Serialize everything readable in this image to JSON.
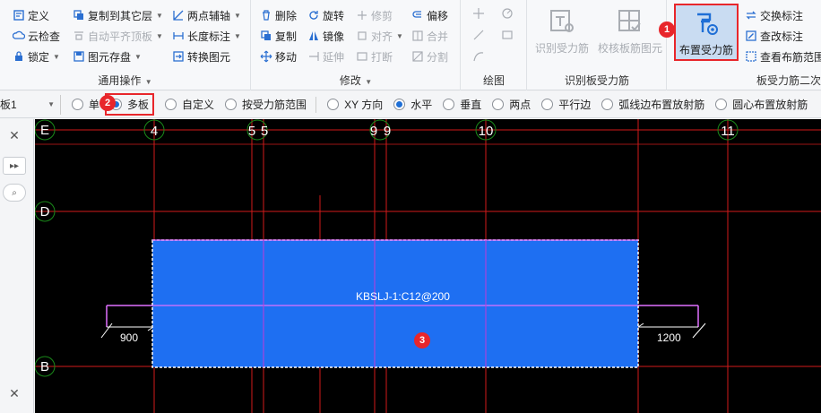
{
  "ribbon": {
    "general": {
      "title": "通用操作",
      "items": [
        "定义",
        "云检查",
        "锁定",
        "复制到其它层",
        "自动平齐顶板",
        "图元存盘",
        "两点辅轴",
        "长度标注",
        "转换图元"
      ]
    },
    "modify": {
      "title": "修改",
      "items": [
        "删除",
        "旋转",
        "修剪",
        "偏移",
        "复制",
        "镜像",
        "对齐",
        "合并",
        "移动",
        "延伸",
        "打断",
        "分割"
      ]
    },
    "draw": {
      "title": "绘图"
    },
    "recognize": {
      "title": "识别板受力筋",
      "identify_label": "识别受力筋",
      "check_label": "校核板筋图元"
    },
    "place": {
      "title": "板受力筋二次",
      "place_label": "布置受力筋",
      "exchange_label": "交换标注",
      "edit_label": "查改标注",
      "view_label": "查看布筋范围"
    }
  },
  "optbar": {
    "layer": "板1",
    "options": [
      "单",
      "多板",
      "自定义",
      "按受力筋范围"
    ],
    "selected_option": "多板",
    "directions": [
      "XY 方向",
      "水平",
      "垂直",
      "两点",
      "平行边",
      "弧线边布置放射筋",
      "圆心布置放射筋"
    ],
    "selected_direction": "水平"
  },
  "canvas": {
    "axis_labels": [
      "E",
      "D",
      "B"
    ],
    "grid_labels": [
      "4",
      "5",
      "5",
      "9",
      "9",
      "10",
      "11"
    ],
    "rebar_label": "KBSLJ-1:C12@200",
    "left_dim": "900",
    "right_dim": "1200"
  },
  "badges": [
    "1",
    "2",
    "3"
  ],
  "colors": {
    "accent": "#1f6fd6",
    "slab": "#1e6ff2",
    "grid": "#d21a1a",
    "rebar": "#e070ff",
    "highlight": "#e8262b"
  }
}
